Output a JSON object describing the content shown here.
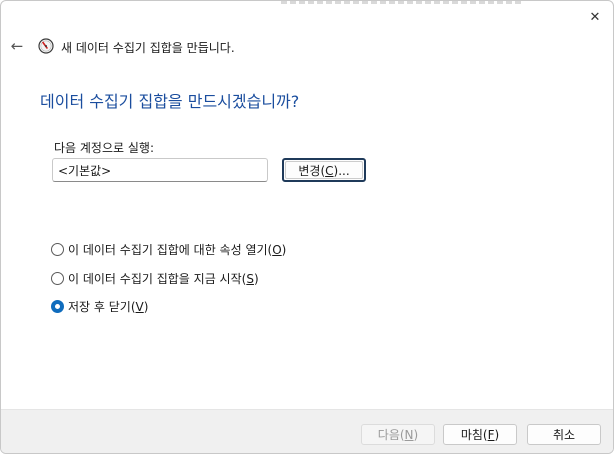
{
  "window": {
    "wizard_title": "새 데이터 수집기 집합을 만듭니다.",
    "close_glyph": "✕",
    "back_glyph": "←"
  },
  "main": {
    "heading": "데이터 수집기 집합을 만드시겠습니까?",
    "run_as_label": "다음 계정으로 실행:",
    "run_as_value": "<기본값>",
    "change_button": {
      "pre": "변경(",
      "key": "C",
      "post": ")..."
    }
  },
  "options": [
    {
      "pre": "이 데이터 수집기 집합에 대한 속성 열기(",
      "key": "O",
      "post": ")",
      "checked": false
    },
    {
      "pre": "이 데이터 수집기 집합을 지금 시작(",
      "key": "S",
      "post": ")",
      "checked": false
    },
    {
      "pre": "저장 후 닫기(",
      "key": "V",
      "post": ")",
      "checked": true
    }
  ],
  "footer": {
    "next": {
      "pre": "다음(",
      "key": "N",
      "post": ")",
      "enabled": false
    },
    "finish": {
      "pre": "마침(",
      "key": "F",
      "post": ")",
      "enabled": true
    },
    "cancel": {
      "label": "취소",
      "enabled": true
    }
  },
  "colors": {
    "heading": "#1a4d9e",
    "accent": "#0f6cbd"
  },
  "icons": {
    "wizard": "performance-monitor-gauge-icon",
    "close": "close-icon",
    "back": "back-arrow-icon"
  }
}
